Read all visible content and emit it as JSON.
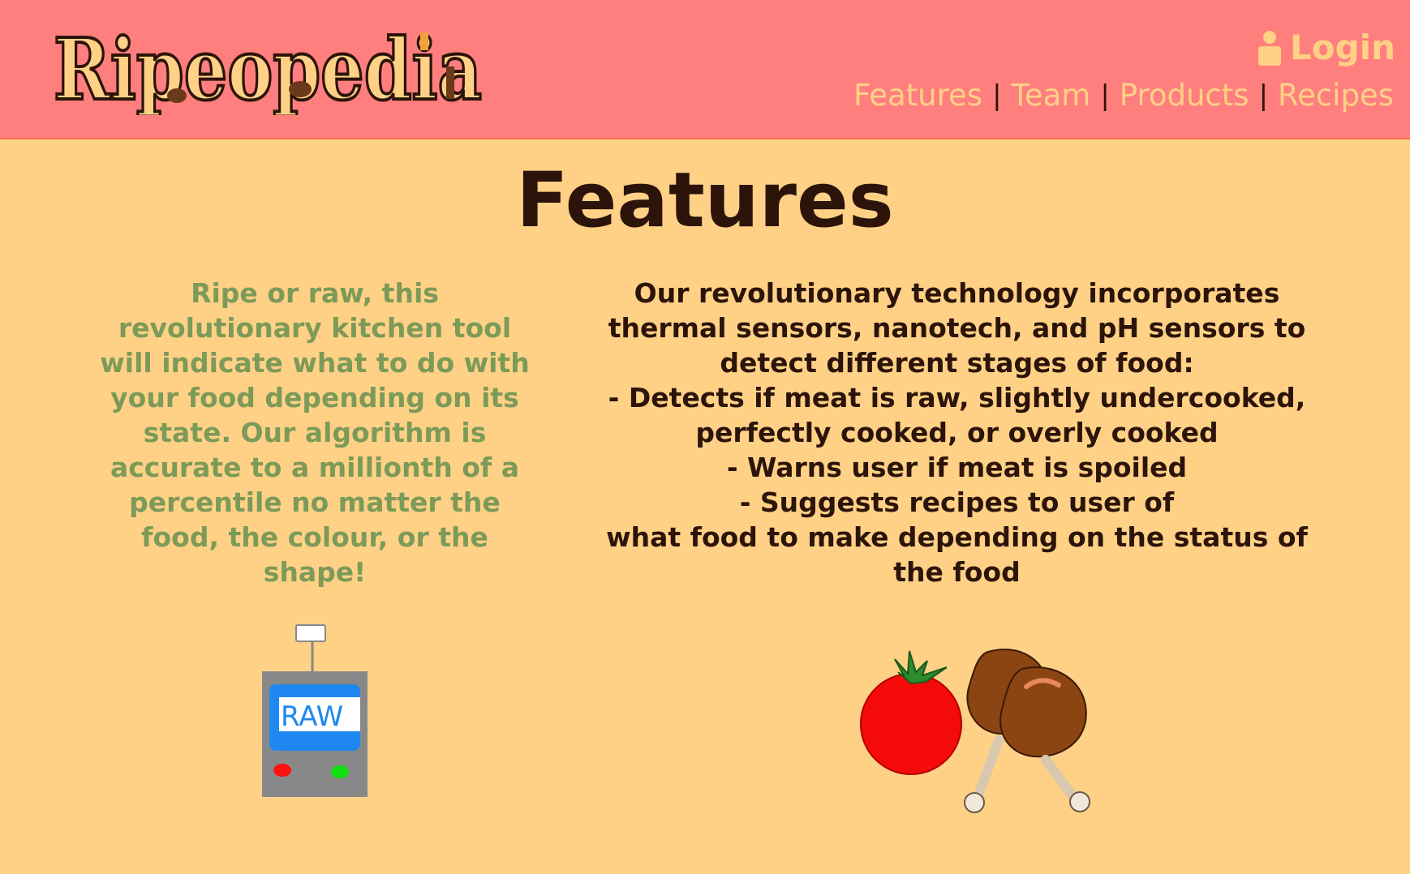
{
  "header": {
    "logo_text": "Ripeopedia",
    "login_label": "Login",
    "nav": [
      {
        "label": "Features"
      },
      {
        "label": "Team"
      },
      {
        "label": "Products"
      },
      {
        "label": "Recipes"
      }
    ],
    "separator": "|"
  },
  "main": {
    "title": "Features",
    "left_paragraph": "Ripe or raw, this revolutionary kitchen tool will indicate what to do with your food depending on its state. Our algorithm is accurate to a millionth of a percentile no matter the food, the colour, or the shape!",
    "right_lines": [
      "Our revolutionary technology incorporates",
      "thermal sensors, nanotech, and pH sensors to",
      "detect different stages of food:",
      "- Detects if meat is raw, slightly undercooked,",
      "perfectly cooked, or overly cooked",
      "- Warns user if meat is spoiled",
      "- Suggests recipes to user of",
      "what food to make depending on the status of",
      "the food"
    ],
    "device_screen_text": "RAW"
  },
  "colors": {
    "header_bg": "#ff7f7e",
    "page_bg": "#ffd186",
    "accent_text": "#ffd186",
    "green_text": "#7c9a58",
    "dark_text": "#2c140a"
  },
  "icons": {
    "login": "person-icon",
    "device": "ripeness-meter-illustration",
    "tomato": "tomato-illustration",
    "drumsticks": "chicken-drumstick-illustration"
  }
}
